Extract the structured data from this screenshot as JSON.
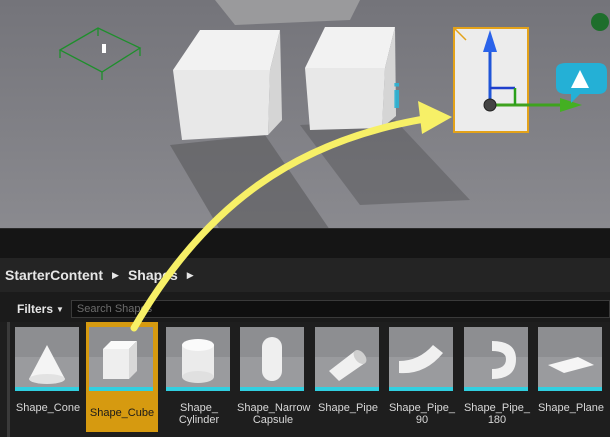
{
  "breadcrumb": [
    "StarterContent",
    "Shapes"
  ],
  "search": {
    "placeholder": "Search Shapes",
    "value": ""
  },
  "filters": {
    "label": "Filters"
  },
  "assets": [
    {
      "label": "Shape_Cone",
      "selected": false,
      "icon": "cone"
    },
    {
      "label": "Shape_Cube",
      "selected": true,
      "icon": "cube"
    },
    {
      "label": "Shape_\nCylinder",
      "selected": false,
      "icon": "cylinder"
    },
    {
      "label": "Shape_Narrow\nCapsule",
      "selected": false,
      "icon": "capsule"
    },
    {
      "label": "Shape_Pipe",
      "selected": false,
      "icon": "pipe"
    },
    {
      "label": "Shape_Pipe_\n90",
      "selected": false,
      "icon": "pipe-90"
    },
    {
      "label": "Shape_Pipe_\n180",
      "selected": false,
      "icon": "pipe-180"
    },
    {
      "label": "Shape_Plane",
      "selected": false,
      "icon": "plane"
    }
  ],
  "colors": {
    "selection": "#d69a10",
    "tile_underline": "#31cfe0",
    "annotation_arrow": "#f7f067"
  }
}
